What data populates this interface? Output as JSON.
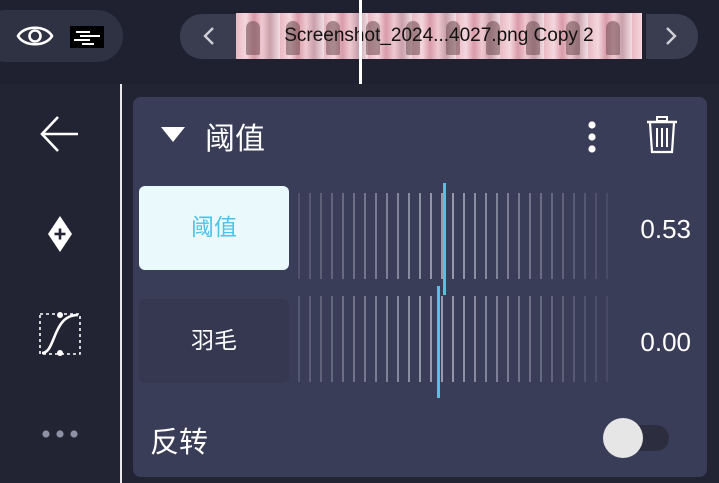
{
  "topbar": {
    "visibility_icon": "eye-icon",
    "prev_icon": "chevron-left-icon",
    "next_icon": "chevron-right-icon",
    "clip_label": "Screenshot_2024...4027.png Copy 2"
  },
  "sidebar": {
    "items": [
      {
        "name": "back",
        "icon": "arrow-left-icon"
      },
      {
        "name": "add-keyframe",
        "icon": "diamond-plus-icon"
      },
      {
        "name": "curve",
        "icon": "curve-icon"
      },
      {
        "name": "more",
        "icon": "ellipsis-icon"
      }
    ]
  },
  "panel": {
    "title": "阈值",
    "params": [
      {
        "label": "阈值",
        "value": "0.53",
        "active": true
      },
      {
        "label": "羽毛",
        "value": "0.00",
        "active": false
      }
    ],
    "invert_label": "反转",
    "invert_on": false
  },
  "colors": {
    "accent": "#4fc3e6",
    "panel_bg": "#3a3d58",
    "app_bg": "#232433"
  }
}
